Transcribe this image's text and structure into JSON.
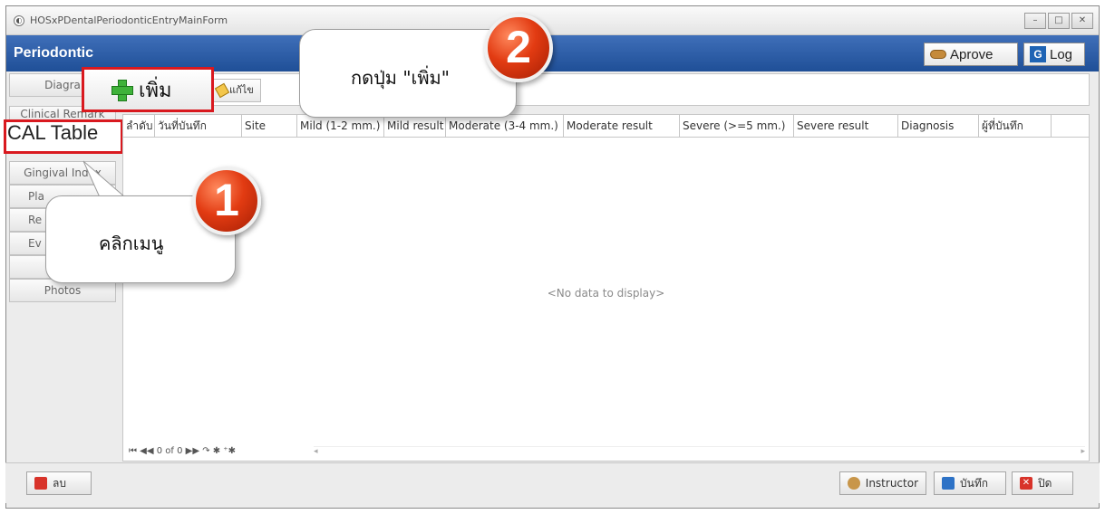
{
  "window": {
    "title": "HOSxPDentalPeriodonticEntryMainForm"
  },
  "header": {
    "title": "Periodontic",
    "approve_label": "Aprove",
    "log_label": "Log"
  },
  "sidebar": {
    "items": [
      {
        "label": "Diagra"
      },
      {
        "label": "Clinical Remark"
      },
      {
        "label": "CAL Table"
      },
      {
        "label": "Gingival Index"
      },
      {
        "label": "Pla"
      },
      {
        "label": "Re"
      },
      {
        "label": "Ev"
      },
      {
        "label": ""
      },
      {
        "label": "Photos"
      }
    ]
  },
  "toolbar": {
    "add_label": "เพิ่ม",
    "edit_label": "แก้ไข"
  },
  "grid": {
    "columns": [
      "ลำดับ",
      "วันที่บันทึก",
      "Site",
      "Mild (1-2 mm.)",
      "Mild result",
      "Moderate (3-4 mm.)",
      "Moderate result",
      "Severe (>=5 mm.)",
      "Severe result",
      "Diagnosis",
      "ผู้ที่บันทึก"
    ],
    "empty_text": "<No data to display>",
    "navigator": "⏮ ◀◀  0 of 0  ▶▶ ↷ ✱ ⁺✱"
  },
  "bottom": {
    "delete_label": "ลบ",
    "instructor_label": "Instructor",
    "save_label": "บันทึก",
    "close_label": "ปิด"
  },
  "callouts": {
    "step1_text": "คลิกเมนู",
    "step2_text": "กดปุ่ม \"เพิ่ม\"",
    "step1_number": "1",
    "step2_number": "2"
  },
  "colors": {
    "header_blue": "#1f4f97",
    "highlight_red": "#d9191f",
    "badge_orange": "#e23b12"
  }
}
